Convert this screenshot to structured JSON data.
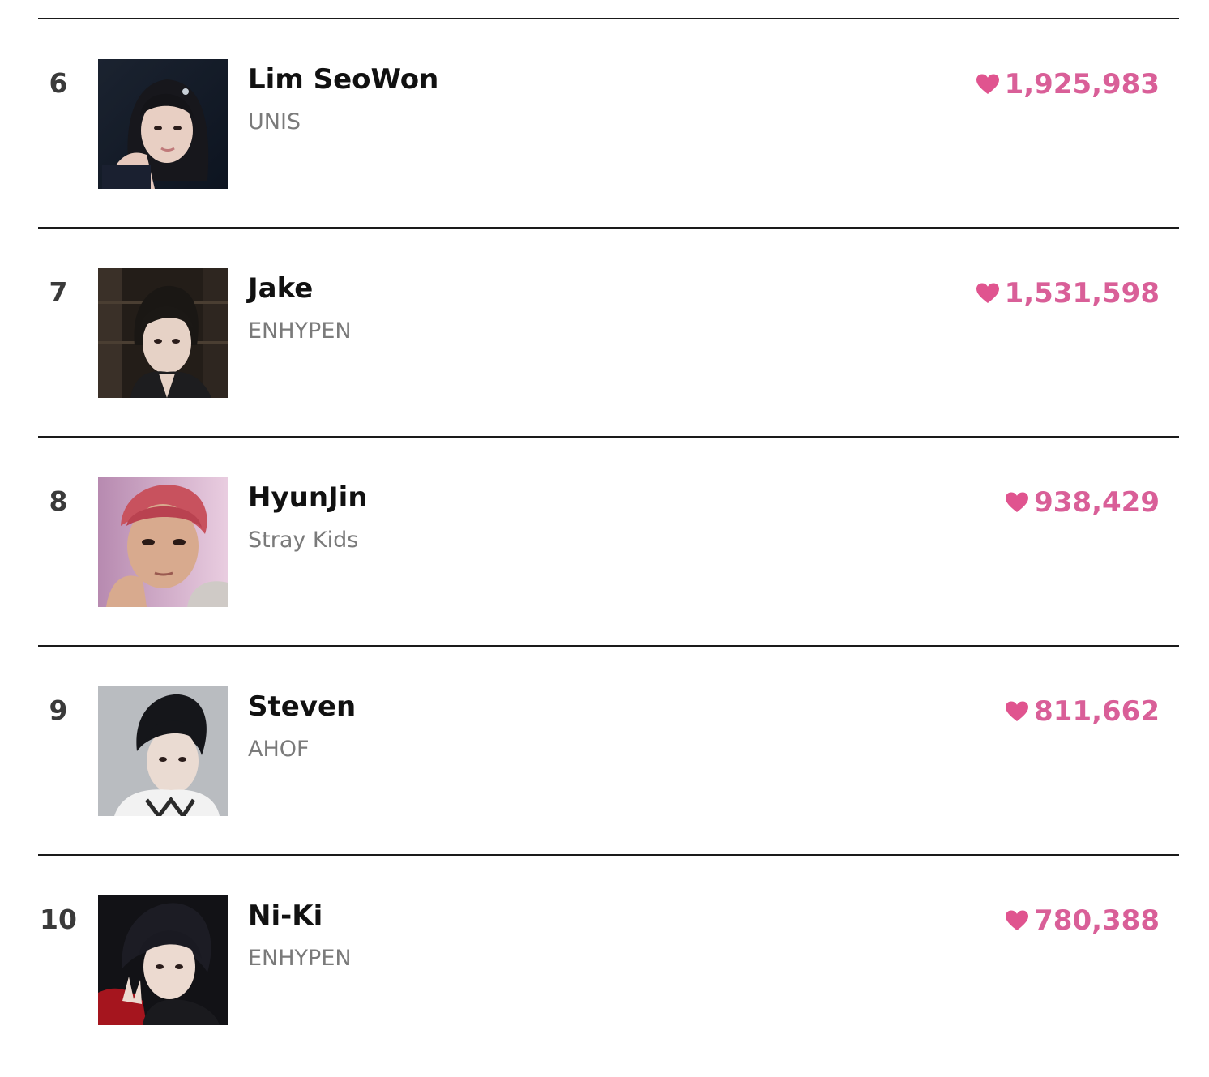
{
  "accent_color": "#d95f98",
  "heart_icon": "heart-icon",
  "rankings": [
    {
      "rank": "6",
      "name": "Lim SeoWon",
      "group": "UNIS",
      "votes": "1,925,983"
    },
    {
      "rank": "7",
      "name": "Jake",
      "group": "ENHYPEN",
      "votes": "1,531,598"
    },
    {
      "rank": "8",
      "name": "HyunJin",
      "group": "Stray Kids",
      "votes": "938,429"
    },
    {
      "rank": "9",
      "name": "Steven",
      "group": "AHOF",
      "votes": "811,662"
    },
    {
      "rank": "10",
      "name": "Ni-Ki",
      "group": "ENHYPEN",
      "votes": "780,388"
    }
  ]
}
